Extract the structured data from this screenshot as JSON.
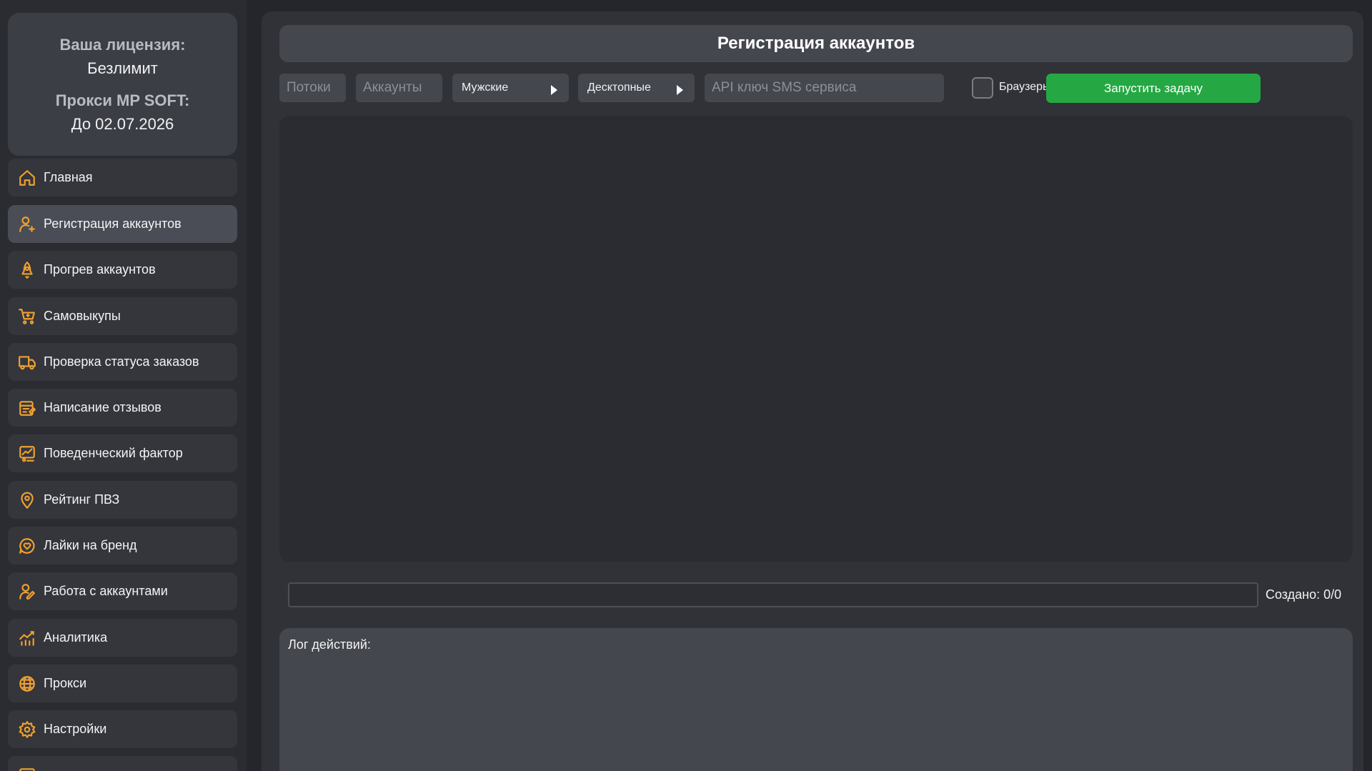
{
  "license": {
    "label": "Ваша лицензия:",
    "value": "Безлимит",
    "proxy_label": "Прокси MP SOFT:",
    "proxy_value": "До 02.07.2026"
  },
  "sidebar": {
    "items": [
      {
        "label": "Главная",
        "icon": "home-icon"
      },
      {
        "label": "Регистрация аккаунтов",
        "icon": "user-plus-icon",
        "active": true
      },
      {
        "label": "Прогрев аккаунтов",
        "icon": "rocket-icon"
      },
      {
        "label": "Самовыкупы",
        "icon": "cart-icon"
      },
      {
        "label": "Проверка статуса заказов",
        "icon": "truck-icon"
      },
      {
        "label": "Написание отзывов",
        "icon": "review-icon"
      },
      {
        "label": "Поведенческий фактор",
        "icon": "behavior-chart-icon"
      },
      {
        "label": "Рейтинг ПВЗ",
        "icon": "map-pin-icon"
      },
      {
        "label": "Лайки на бренд",
        "icon": "heart-bubble-icon"
      },
      {
        "label": "Работа с аккаунтами",
        "icon": "user-edit-icon"
      },
      {
        "label": "Аналитика",
        "icon": "analytics-icon"
      },
      {
        "label": "Прокси",
        "icon": "globe-icon"
      },
      {
        "label": "Настройки",
        "icon": "gear-icon"
      },
      {
        "label": "",
        "icon": "document-icon"
      }
    ]
  },
  "main": {
    "title": "Регистрация аккаунтов",
    "toolbar": {
      "threads_placeholder": "Потоки",
      "accounts_placeholder": "Аккаунты",
      "gender_select": "Мужские",
      "device_select": "Десктопные",
      "api_key_placeholder": "API ключ SMS сервиса",
      "browsers_label": "Браузеры",
      "run_button": "Запустить задачу"
    },
    "progress": {
      "value": 0
    },
    "created_text": "Создано: 0/0",
    "log_label": "Лог действий:"
  },
  "colors": {
    "accent_green": "#25a843",
    "icon_orange": "#f0a030"
  }
}
